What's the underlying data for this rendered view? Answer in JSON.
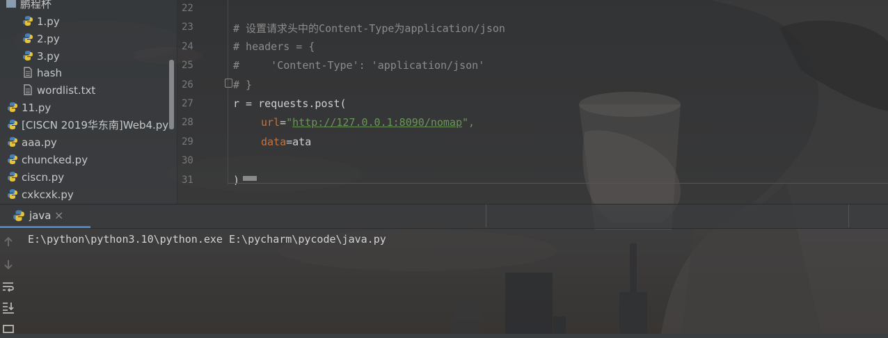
{
  "project_tree": {
    "folder": "鹏程杯",
    "items": [
      {
        "label": "1.py",
        "type": "python"
      },
      {
        "label": "2.py",
        "type": "python"
      },
      {
        "label": "3.py",
        "type": "python"
      },
      {
        "label": "hash",
        "type": "text"
      },
      {
        "label": "wordlist.txt",
        "type": "text"
      },
      {
        "label": "11.py",
        "type": "python"
      },
      {
        "label": "[CISCN 2019华东南]Web4.py",
        "type": "python"
      },
      {
        "label": "aaa.py",
        "type": "python"
      },
      {
        "label": "chuncked.py",
        "type": "python"
      },
      {
        "label": "ciscn.py",
        "type": "python"
      },
      {
        "label": "cxkcxk.py",
        "type": "python"
      }
    ]
  },
  "editor": {
    "line_numbers": [
      "22",
      "23",
      "24",
      "25",
      "26",
      "27",
      "28",
      "29",
      "30",
      "31"
    ],
    "line23": "# 设置请求头中的Content-Type为application/json",
    "line24": "# headers = {",
    "line25": "#     'Content-Type': 'application/json'",
    "line26": "# }",
    "line27": "r = requests.post(",
    "line28_param": "url",
    "line28_eq": "=",
    "line28_q1": "\"",
    "line28_url": "http://127.0.0.1:8090/nomap",
    "line28_q2": "\",",
    "line29_param": "data",
    "line29_rest": "=ata",
    "line31": ")"
  },
  "run_panel": {
    "tab_label": "java",
    "tab_close": "×",
    "console_output": "E:\\python\\python3.10\\python.exe E:\\pycharm\\pycode\\java.py"
  },
  "colors": {
    "accent": "#4a88c7",
    "comment": "#8c8c8c",
    "param": "#c9733b",
    "string": "#6a9759"
  }
}
